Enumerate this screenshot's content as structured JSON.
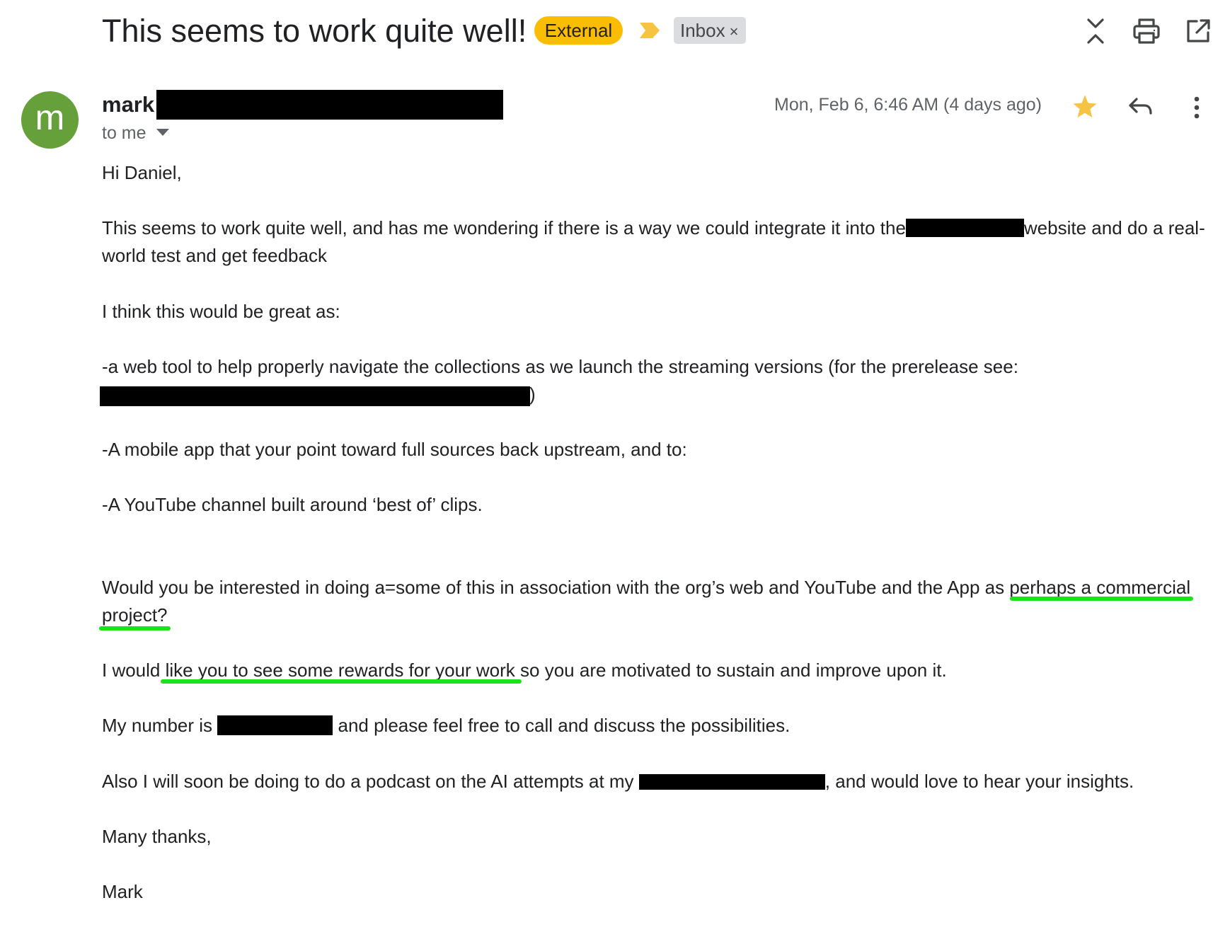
{
  "header": {
    "subject": "This seems to work quite well!",
    "external_badge": "External",
    "inbox_label": "Inbox",
    "inbox_remove": "×",
    "icons": [
      "importance-marker-icon",
      "expand-collapse-icon",
      "print-icon",
      "open-in-new-window-icon"
    ]
  },
  "sender": {
    "avatar_letter": "m",
    "name": "mark",
    "recipient": "to me",
    "date": "Mon, Feb 6, 6:46 AM (4 days ago)",
    "icons": [
      "star-icon",
      "reply-icon",
      "more-vertical-icon"
    ]
  },
  "colors": {
    "external_badge": "#fbbc04",
    "avatar": "#65a03a",
    "star": "#f6c343",
    "highlight_underline": "#18e418"
  },
  "message": {
    "greeting": "Hi Daniel,",
    "p1_a": "This seems to work quite well, and has me wondering if there is a way we could integrate it into the",
    "p1_b": "website and do a real-",
    "p1_c": "world test and get feedback",
    "p2": "I think this would be great as:",
    "p3_a": "-a web tool to help properly navigate the collections as we launch the streaming versions (for the prerelease see:",
    "p3_b": ")",
    "p4": "-A mobile app that your point toward full sources back upstream, and to:",
    "p5": "-A YouTube channel built around ‘best of’ clips.",
    "p6_a": "Would you be interested in doing a=some of this in association with the org’s web and YouTube and the App as ",
    "p6_b": "perhaps a commercial",
    "p6_c": "project?",
    "p7_a": "I would ",
    "p7_b": "like you to see some rewards for your work",
    "p7_c": " so you are motivated to sustain and improve upon it.",
    "p8_a": "My number is ",
    "p8_b": " and please feel free to call and discuss the possibilities.",
    "p9_a": "Also I will soon be doing to do a podcast on the AI attempts at my ",
    "p9_b": ", and would love to hear your insights.",
    "closing": "Many thanks,",
    "signature": "Mark"
  }
}
